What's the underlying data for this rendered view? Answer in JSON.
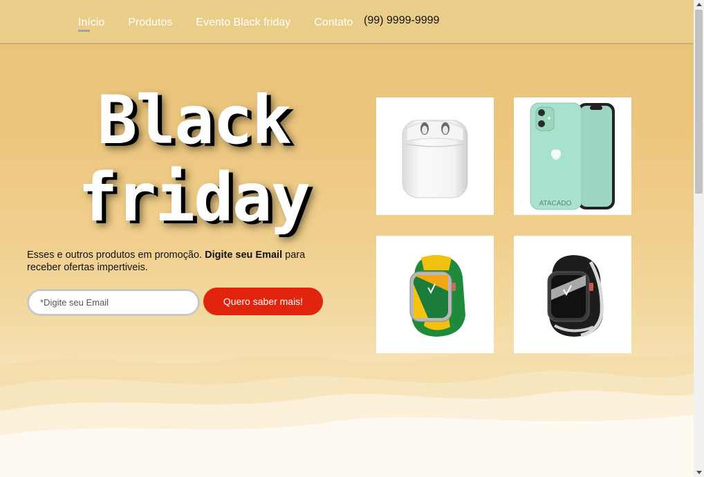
{
  "nav": {
    "items": [
      {
        "label": "Início",
        "active": true
      },
      {
        "label": "Produtos"
      },
      {
        "label": "Evento Black friday"
      },
      {
        "label": "Contato"
      }
    ],
    "phone": "(99) 9999-9999"
  },
  "hero": {
    "title_line1": "Black",
    "title_line2": "friday",
    "tagline_pre": "Esses e outros produtos em promoção. ",
    "tagline_bold": "Digite seu Email",
    "tagline_post": " para receber ofertas impertiveis.",
    "email_placeholder": "*Digite seu Email",
    "cta_label": "Quero saber mais!"
  },
  "products": [
    {
      "icon": "airpods-icon"
    },
    {
      "icon": "iphone-icon",
      "watermark": "ATACADO"
    },
    {
      "icon": "green-watch-icon"
    },
    {
      "icon": "black-watch-icon"
    }
  ],
  "colors": {
    "accent": "#e0240e",
    "background": "#ebc57d"
  }
}
